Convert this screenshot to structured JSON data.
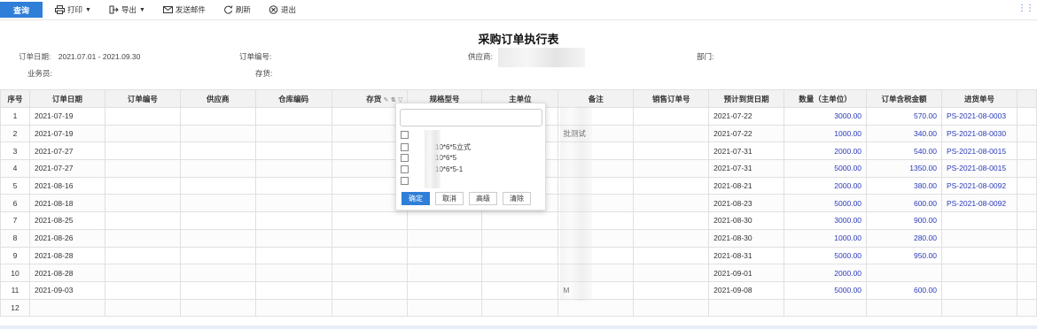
{
  "toolbar": {
    "query": "查询",
    "print": "打印",
    "export": "导出",
    "send_mail": "发送邮件",
    "refresh": "刷新",
    "exit": "退出",
    "more": "⋮⋮"
  },
  "report": {
    "title": "采购订单执行表",
    "order_date_label": "订单日期:",
    "order_date_value": "2021.07.01 - 2021.09.30",
    "order_no_label": "订单编号:",
    "supplier_label": "供应商:",
    "department_label": "部门:",
    "salesman_label": "业务员:",
    "stock_label": "存货:"
  },
  "table": {
    "headers": [
      "序号",
      "订单日期",
      "订单编号",
      "供应商",
      "仓库编码",
      "存货",
      "规格型号",
      "主单位",
      "备注",
      "销售订单号",
      "预计到货日期",
      "数量（主单位）",
      "订单含税金额",
      "进货单号"
    ],
    "rows": [
      {
        "no": "1",
        "date": "2021-07-19",
        "note": "",
        "eta": "2021-07-22",
        "qty": "3000.00",
        "amount": "570.00",
        "receipt": "PS-2021-08-0003"
      },
      {
        "no": "2",
        "date": "2021-07-19",
        "note": "批测试",
        "eta": "2021-07-22",
        "qty": "1000.00",
        "amount": "340.00",
        "receipt": "PS-2021-08-0030"
      },
      {
        "no": "3",
        "date": "2021-07-27",
        "note": "",
        "eta": "2021-07-31",
        "qty": "2000.00",
        "amount": "540.00",
        "receipt": "PS-2021-08-0015"
      },
      {
        "no": "4",
        "date": "2021-07-27",
        "note": "",
        "eta": "2021-07-31",
        "qty": "5000.00",
        "amount": "1350.00",
        "receipt": "PS-2021-08-0015"
      },
      {
        "no": "5",
        "date": "2021-08-16",
        "note": "",
        "eta": "2021-08-21",
        "qty": "2000.00",
        "amount": "380.00",
        "receipt": "PS-2021-08-0092"
      },
      {
        "no": "6",
        "date": "2021-08-18",
        "note": "",
        "eta": "2021-08-23",
        "qty": "5000.00",
        "amount": "600.00",
        "receipt": "PS-2021-08-0092"
      },
      {
        "no": "7",
        "date": "2021-08-25",
        "note": "",
        "eta": "2021-08-30",
        "qty": "3000.00",
        "amount": "900.00",
        "receipt": ""
      },
      {
        "no": "8",
        "date": "2021-08-26",
        "note": "",
        "eta": "2021-08-30",
        "qty": "1000.00",
        "amount": "280.00",
        "receipt": ""
      },
      {
        "no": "9",
        "date": "2021-08-28",
        "note": "",
        "eta": "2021-08-31",
        "qty": "5000.00",
        "amount": "950.00",
        "receipt": ""
      },
      {
        "no": "10",
        "date": "2021-08-28",
        "note": "",
        "eta": "2021-09-01",
        "qty": "2000.00",
        "amount": "",
        "receipt": ""
      },
      {
        "no": "11",
        "date": "2021-09-03",
        "note": "M",
        "eta": "2021-09-08",
        "qty": "5000.00",
        "amount": "600.00",
        "receipt": ""
      },
      {
        "no": "12",
        "date": "",
        "note": "",
        "eta": "",
        "qty": "",
        "amount": "",
        "receipt": ""
      }
    ]
  },
  "filter_popup": {
    "items": [
      "",
      "10*6*5立式",
      "10*6*5",
      "10*6*5-1",
      ""
    ],
    "confirm": "确定",
    "cancel": "取消",
    "advanced": "高级",
    "clear": "清除"
  }
}
